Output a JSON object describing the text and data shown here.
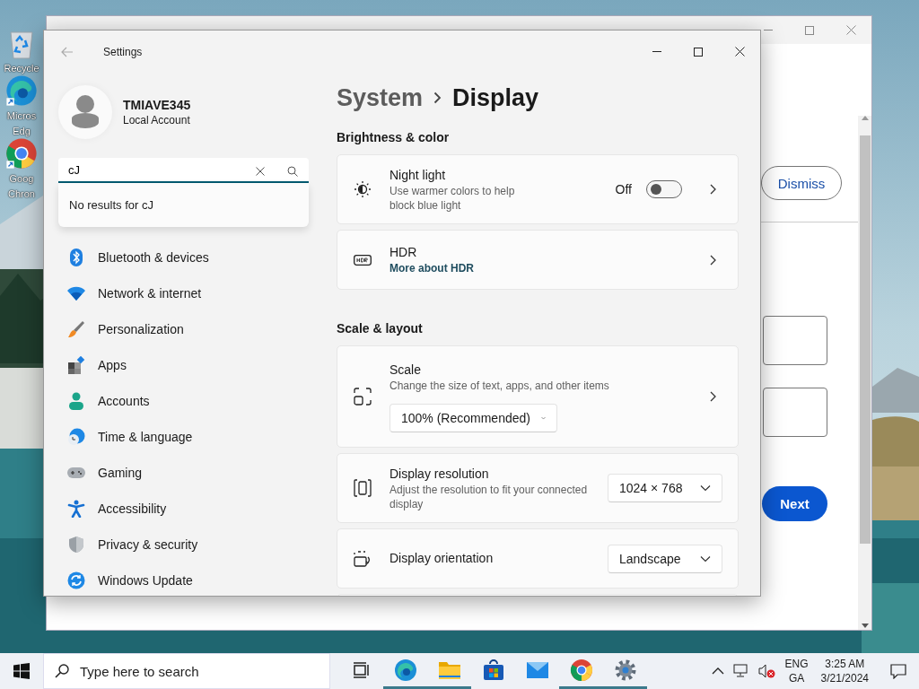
{
  "desktop": {
    "icons": [
      {
        "lines": [
          "Recycle"
        ]
      },
      {
        "lines": [
          "Micros",
          "Edg"
        ]
      },
      {
        "lines": [
          "Goog",
          "Chron"
        ]
      }
    ]
  },
  "browser_window": {
    "dismiss_button": "Dismiss",
    "next_button": "Next"
  },
  "settings": {
    "title": "Settings",
    "user": {
      "name": "TMIAVE345",
      "account": "Local Account"
    },
    "search": {
      "value": "cJ",
      "no_results": "No results for cJ"
    },
    "nav": [
      {
        "label": "Bluetooth & devices"
      },
      {
        "label": "Network & internet"
      },
      {
        "label": "Personalization"
      },
      {
        "label": "Apps"
      },
      {
        "label": "Accounts"
      },
      {
        "label": "Time & language"
      },
      {
        "label": "Gaming"
      },
      {
        "label": "Accessibility"
      },
      {
        "label": "Privacy & security"
      },
      {
        "label": "Windows Update"
      }
    ],
    "breadcrumb": [
      "System",
      "Display"
    ],
    "sections": [
      {
        "title": "Brightness & color",
        "cards": [
          {
            "kind": "toggle",
            "title": "Night light",
            "description": "Use warmer colors to help block blue light",
            "state_label": "Off",
            "on": false
          },
          {
            "kind": "link",
            "title": "HDR",
            "link": "More about HDR"
          }
        ]
      },
      {
        "title": "Scale & layout",
        "cards": [
          {
            "kind": "scale",
            "title": "Scale",
            "description": "Change the size of text, apps, and other items",
            "value": "100% (Recommended)"
          },
          {
            "kind": "select",
            "title": "Display resolution",
            "description": "Adjust the resolution to fit your connected display",
            "value": "1024 × 768"
          },
          {
            "kind": "select",
            "title": "Display orientation",
            "value": "Landscape"
          }
        ]
      }
    ]
  },
  "taskbar": {
    "search_placeholder": "Type here to search",
    "apps": [
      {
        "running": false
      },
      {
        "running": true
      },
      {
        "running": true
      },
      {
        "running": false
      },
      {
        "running": false
      },
      {
        "running": true
      },
      {
        "running": true
      }
    ],
    "tray": {
      "language": "ENG",
      "layout": "GA",
      "time": "3:25 AM",
      "date": "3/21/2024"
    }
  }
}
